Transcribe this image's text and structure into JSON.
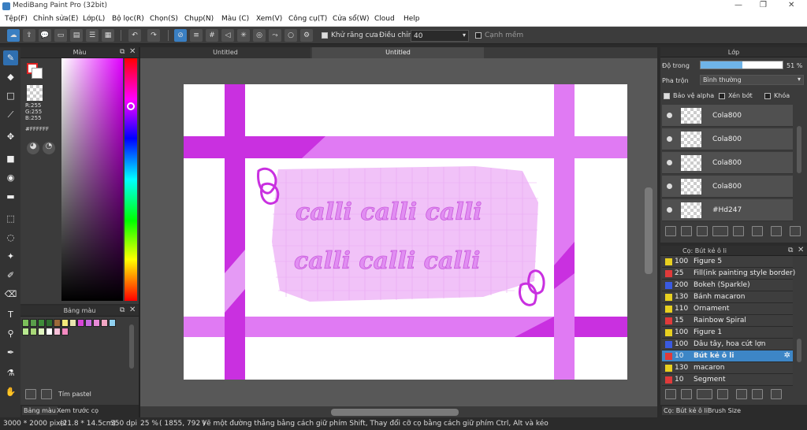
{
  "app": {
    "title": "MediBang Paint Pro (32bit)"
  },
  "menu": [
    "Tệp(F)",
    "Chỉnh sửa(E)",
    "Lớp(L)",
    "Bộ lọc(R)",
    "Chọn(S)",
    "Chụp(N)",
    "Màu (C)",
    "Xem(V)",
    "Công cụ(T)",
    "Cửa sổ(W)",
    "Cloud",
    "Help"
  ],
  "toolbar": {
    "antialias_label": "Khử răng cưa",
    "adjust_label": "Điều chỉnh",
    "adjust_value": "40",
    "edge_label": "Cạnh mềm"
  },
  "color_panel": {
    "title": "Màu",
    "r": "R:255",
    "g": "G:255",
    "b": "B:255",
    "hex": "#FFFFFF"
  },
  "palette_panel": {
    "title": "Bảng màu",
    "palette_name": "Tím pastel",
    "swatches": [
      "#7cbf5a",
      "#5a9e4a",
      "#3f8d3a",
      "#2f6f2f",
      "#9c6a3a",
      "#f4e97a",
      "#e8e4b0",
      "#d845d8",
      "#c86be0",
      "#e88ad8",
      "#f2a7c4",
      "#8fd0f0",
      "#b8e890",
      "#a8d878",
      "#dff4c0",
      "#ffffff",
      "#f8c0d8",
      "#f48ac0"
    ],
    "tab1": "Bảng màu",
    "tab2": "Xem trước cọ"
  },
  "canvas": {
    "tab1": "Untitled",
    "tab2": "Untitled",
    "text_line1": "calli calli calli",
    "text_line2": "calli calli calli"
  },
  "layers_panel": {
    "title": "Lớp",
    "opacity_label": "Độ trong",
    "opacity_value": "51 %",
    "opacity_fraction": 0.51,
    "blend_label": "Pha trộn",
    "blend_value": "Bình thường",
    "protect_alpha": "Bảo vệ alpha",
    "clipping": "Xén bớt",
    "lock": "Khóa",
    "layers": [
      "Cola800",
      "Cola800",
      "Cola800",
      "Cola800",
      "#Hd247"
    ]
  },
  "brush_panel": {
    "title": "Cọ: Bút kẻ ô li",
    "brushes": [
      {
        "size": "100",
        "name": "Figure 5",
        "color": "#e8d020"
      },
      {
        "size": "25",
        "name": "Fill(ink painting style border)",
        "color": "#e03a3a"
      },
      {
        "size": "200",
        "name": "Bokeh (Sparkle)",
        "color": "#3a5ae0"
      },
      {
        "size": "130",
        "name": "Bánh macaron",
        "color": "#e8d020"
      },
      {
        "size": "110",
        "name": "Ornament",
        "color": "#e8d020"
      },
      {
        "size": "15",
        "name": "Rainbow Spiral",
        "color": "#e03a3a"
      },
      {
        "size": "100",
        "name": "Figure 1",
        "color": "#e8d020"
      },
      {
        "size": "100",
        "name": "Dâu tây, hoa cứt lợn",
        "color": "#3a5ae0"
      },
      {
        "size": "10",
        "name": "Bút kẻ ô li",
        "color": "#e03a3a",
        "selected": true
      },
      {
        "size": "130",
        "name": "macaron",
        "color": "#e8d020"
      },
      {
        "size": "10",
        "name": "Segment",
        "color": "#e03a3a"
      }
    ],
    "tab1": "Cọ: Bút kẻ ô li",
    "tab2": "Brush Size"
  },
  "status": {
    "size": "3000 * 2000 pixel",
    "cm": "(21.8 * 14.5cm)",
    "dpi": "350 dpi",
    "zoom": "25 %",
    "coords": "( 1855, 792 )",
    "hint": "Vẽ một đường thẳng bằng cách giữ phím Shift, Thay đổi cỡ cọ bằng cách giữ phím Ctrl, Alt và kéo"
  },
  "colors": {
    "accent": "#3a7fc2",
    "magenta": "#c930e0",
    "pink": "#e59af5",
    "light": "#f1c2f8"
  }
}
